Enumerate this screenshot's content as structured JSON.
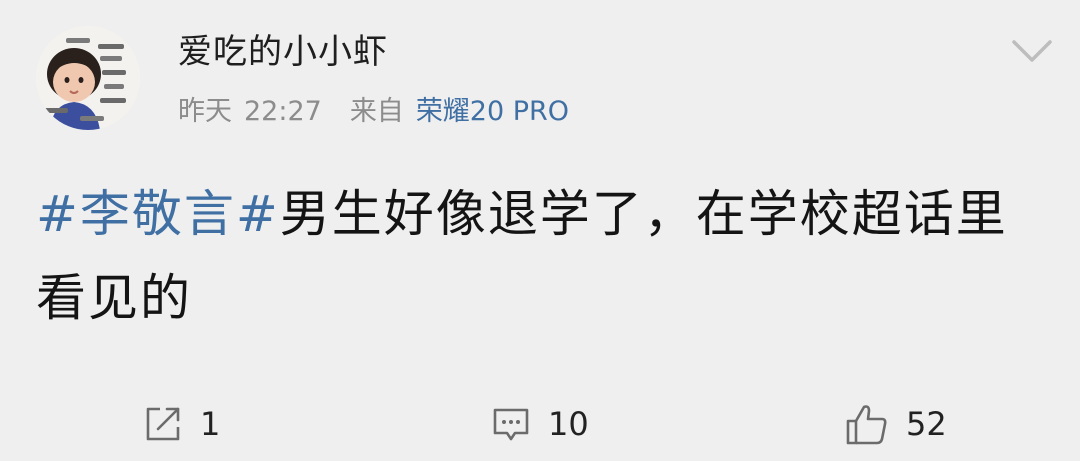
{
  "post": {
    "username": "爱吃的小小虾",
    "date_label": "昨天",
    "time": "22:27",
    "from_label": "来自",
    "device": "荣耀20 PRO",
    "hashtag": "#李敬言#",
    "text": "男生好像退学了，在学校超话里看见的"
  },
  "actions": {
    "repost_count": "1",
    "comment_count": "10",
    "like_count": "52"
  },
  "icons": {
    "menu": "chevron-down-icon",
    "repost": "repost-icon",
    "comment": "comment-icon",
    "like": "like-icon"
  },
  "colors": {
    "link": "#3f6fa3",
    "meta": "#8c8c8c",
    "background": "#efefef"
  }
}
